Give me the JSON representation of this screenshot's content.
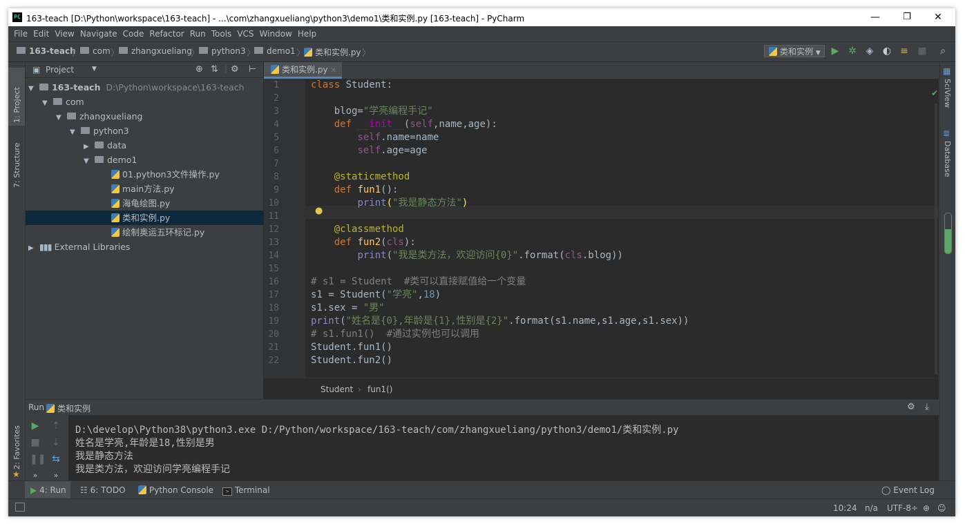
{
  "window": {
    "title": "163-teach [D:\\Python\\workspace\\163-teach] - ...\\com\\zhangxueliang\\python3\\demo1\\类和实例.py [163-teach] - PyCharm",
    "minimize": "—",
    "restore": "❐",
    "close": "✕"
  },
  "menu": [
    "File",
    "Edit",
    "View",
    "Navigate",
    "Code",
    "Refactor",
    "Run",
    "Tools",
    "VCS",
    "Window",
    "Help"
  ],
  "breadcrumbs": [
    "163-teach",
    "com",
    "zhangxueliang",
    "python3",
    "demo1",
    "类和实例.py"
  ],
  "run_config": "类和实例",
  "left_strip": {
    "project": "1: Project",
    "structure": "7: Structure",
    "favorites": "2: Favorites"
  },
  "right_strip": {
    "sciview": "SciView",
    "database": "Database"
  },
  "project_panel": {
    "title": "Project",
    "tree": [
      {
        "label": "163-teach",
        "path": "D:\\Python\\workspace\\163-teach"
      },
      {
        "label": "com"
      },
      {
        "label": "zhangxueliang"
      },
      {
        "label": "python3"
      },
      {
        "label": "data"
      },
      {
        "label": "demo1"
      },
      {
        "label": "01.python3文件操作.py"
      },
      {
        "label": "main方法.py"
      },
      {
        "label": "海龟绘图.py"
      },
      {
        "label": "类和实例.py"
      },
      {
        "label": "绘制奥运五环标记.py"
      },
      {
        "label": "External Libraries"
      }
    ]
  },
  "editor": {
    "tab": "类和实例.py",
    "line_numbers": [
      "1",
      "2",
      "3",
      "4",
      "5",
      "6",
      "7",
      "8",
      "9",
      "10",
      "11",
      "12",
      "13",
      "14",
      "15",
      "16",
      "17",
      "18",
      "19",
      "20",
      "21",
      "22"
    ],
    "breadcrumb": [
      "Student",
      "fun1()"
    ]
  },
  "run_panel": {
    "label": "Run",
    "config": "类和实例",
    "output": [
      "D:\\develop\\Python38\\python3.exe D:/Python/workspace/163-teach/com/zhangxueliang/python3/demo1/类和实例.py",
      "姓名是学亮,年龄是18,性别是男",
      "我是静态方法",
      "我是类方法，欢迎访问学亮编程手记"
    ]
  },
  "bottom_tabs": {
    "run": "4: Run",
    "todo": "6: TODO",
    "console": "Python Console",
    "terminal": "Terminal",
    "event_log": "Event Log"
  },
  "status": {
    "position": "10:24",
    "separator": "n/a",
    "encoding": "UTF-8÷"
  }
}
